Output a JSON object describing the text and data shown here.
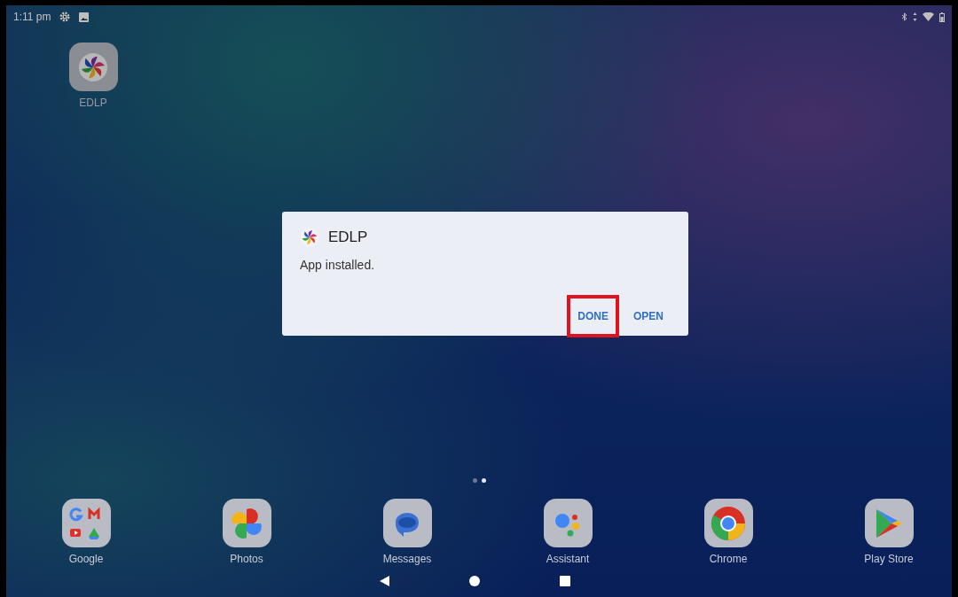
{
  "status_bar": {
    "time": "1:11 pm"
  },
  "home_apps": [
    {
      "label": "EDLP",
      "kind": "edlp"
    }
  ],
  "dialog": {
    "app_name": "EDLP",
    "message": "App installed.",
    "buttons": [
      {
        "label": "DONE",
        "highlighted": true
      },
      {
        "label": "OPEN",
        "highlighted": false
      }
    ]
  },
  "page_dots": [
    {
      "selected": false
    },
    {
      "selected": true
    }
  ],
  "dock": [
    {
      "label": "Google",
      "kind": "folder"
    },
    {
      "label": "Photos",
      "kind": "photos"
    },
    {
      "label": "Messages",
      "kind": "messages"
    },
    {
      "label": "Assistant",
      "kind": "assistant"
    },
    {
      "label": "Chrome",
      "kind": "chrome"
    },
    {
      "label": "Play Store",
      "kind": "play"
    }
  ]
}
